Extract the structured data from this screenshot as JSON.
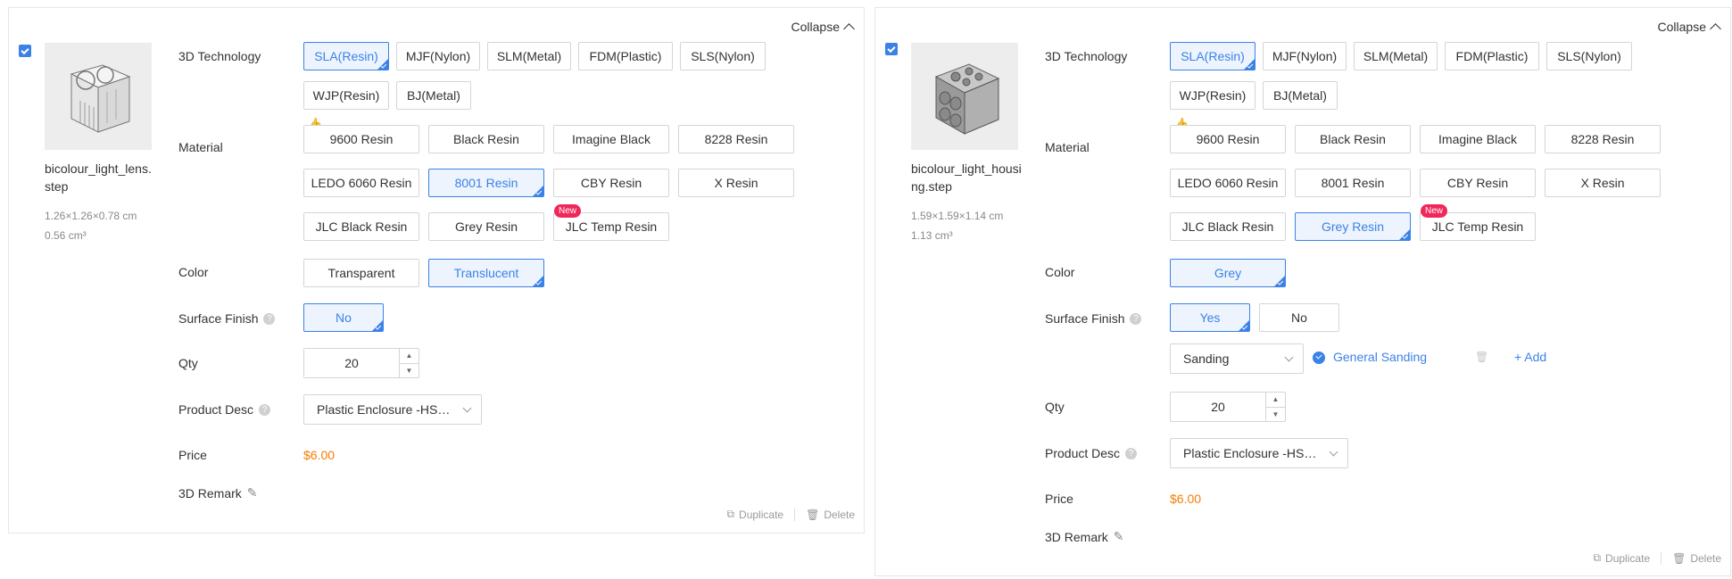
{
  "left": {
    "collapse_label": "Collapse",
    "file_name": "bicolour_light_lens.step",
    "dimensions": "1.26×1.26×0.78 cm",
    "volume": "0.56 cm³",
    "labels": {
      "technology": "3D Technology",
      "material": "Material",
      "color": "Color",
      "surface_finish": "Surface Finish",
      "qty": "Qty",
      "product_desc": "Product Desc",
      "price": "Price",
      "remark": "3D Remark"
    },
    "technologies": [
      "SLA(Resin)",
      "MJF(Nylon)",
      "SLM(Metal)",
      "FDM(Plastic)",
      "SLS(Nylon)",
      "WJP(Resin)",
      "BJ(Metal)"
    ],
    "materials": [
      "9600 Resin",
      "Black Resin",
      "Imagine Black",
      "8228 Resin",
      "LEDO 6060 Resin",
      "8001 Resin",
      "CBY Resin",
      "X Resin",
      "JLC Black Resin",
      "Grey Resin",
      "JLC Temp Resin"
    ],
    "new_badge": "New",
    "colors": [
      "Transparent",
      "Translucent"
    ],
    "surface_finish": [
      "No"
    ],
    "qty": "20",
    "product_desc": "Plastic Enclosure -HS…",
    "price": "$6.00",
    "duplicate": "Duplicate",
    "delete": "Delete"
  },
  "right": {
    "collapse_label": "Collapse",
    "file_name": "bicolour_light_housing.step",
    "dimensions": "1.59×1.59×1.14 cm",
    "volume": "1.13 cm³",
    "labels": {
      "technology": "3D Technology",
      "material": "Material",
      "color": "Color",
      "surface_finish": "Surface Finish",
      "qty": "Qty",
      "product_desc": "Product Desc",
      "price": "Price",
      "remark": "3D Remark"
    },
    "technologies": [
      "SLA(Resin)",
      "MJF(Nylon)",
      "SLM(Metal)",
      "FDM(Plastic)",
      "SLS(Nylon)",
      "WJP(Resin)",
      "BJ(Metal)"
    ],
    "materials": [
      "9600 Resin",
      "Black Resin",
      "Imagine Black",
      "8228 Resin",
      "LEDO 6060 Resin",
      "8001 Resin",
      "CBY Resin",
      "X Resin",
      "JLC Black Resin",
      "Grey Resin",
      "JLC Temp Resin"
    ],
    "new_badge": "New",
    "colors": [
      "Grey"
    ],
    "surface_finish": [
      "Yes",
      "No"
    ],
    "sanding_select": "Sanding",
    "sanding_option": "General Sanding",
    "add_label": "+ Add",
    "qty": "20",
    "product_desc": "Plastic Enclosure -HS…",
    "price": "$6.00",
    "duplicate": "Duplicate",
    "delete": "Delete"
  },
  "accent_color": "#3b82e8",
  "price_color": "#f57c00",
  "new_badge_color": "#f0285a"
}
